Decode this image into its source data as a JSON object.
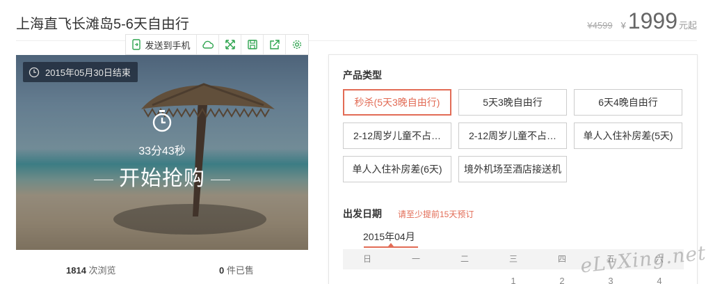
{
  "product": {
    "title": "上海直飞长滩岛5-6天自由行",
    "old_price": "¥4599",
    "currency_symbol": "¥",
    "price": "1999",
    "price_suffix": "元起"
  },
  "share_bar": {
    "send_label": "发送到手机",
    "icons": [
      "mobile-send-icon",
      "cloud-icon",
      "expand-icon",
      "save-icon",
      "share-icon",
      "settings-icon"
    ]
  },
  "hero": {
    "end_date": "2015年05月30日结束",
    "countdown": "33分43秒",
    "buy_label": "开始抢购"
  },
  "stats": {
    "views_count": "1814",
    "views_label": "次浏览",
    "sold_count": "0",
    "sold_label": "件已售"
  },
  "product_type": {
    "label": "产品类型",
    "options": [
      {
        "label": "秒杀(5天3晚自由行)",
        "active": true
      },
      {
        "label": "5天3晚自由行",
        "active": false
      },
      {
        "label": "6天4晚自由行",
        "active": false
      },
      {
        "label": "2-12周岁儿童不占…",
        "active": false
      },
      {
        "label": "2-12周岁儿童不占…",
        "active": false
      },
      {
        "label": "单人入住补房差(5天)",
        "active": false
      },
      {
        "label": "单人入住补房差(6天)",
        "active": false
      },
      {
        "label": "境外机场至酒店接送机",
        "active": false
      }
    ]
  },
  "departure": {
    "label": "出发日期",
    "notice": "请至少提前15天预订",
    "month": "2015年04月",
    "weekdays": [
      "日",
      "一",
      "二",
      "三",
      "四",
      "五",
      "六"
    ],
    "first_row": [
      "",
      "",
      "",
      "1",
      "2",
      "3",
      "4"
    ]
  },
  "watermark": "eLvXing.net",
  "colors": {
    "accent": "#e26b55",
    "share_icon": "#2ea44f"
  }
}
